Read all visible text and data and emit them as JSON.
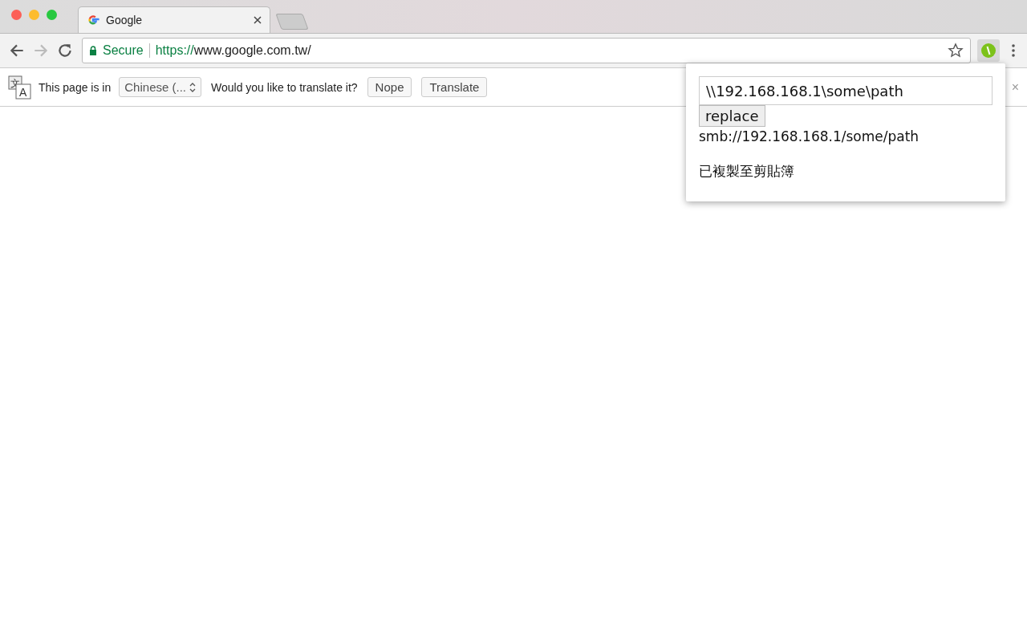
{
  "tabs": [
    {
      "title": "Google",
      "selected": true
    }
  ],
  "address_bar": {
    "security": "Secure",
    "scheme": "https://",
    "url": "www.google.com.tw/"
  },
  "translate_bar": {
    "icon_glyphs": [
      "文",
      "A"
    ],
    "prefix": "This page is in",
    "language": "Chinese (...",
    "question": "Would you like to translate it?",
    "buttons": [
      "Nope",
      "Translate"
    ],
    "close": "×"
  },
  "popup": {
    "input_value": "\\\\192.168.168.1\\some\\path",
    "button": "replace",
    "result": "smb://192.168.168.1/some/path",
    "message": "已複製至剪貼簿"
  }
}
